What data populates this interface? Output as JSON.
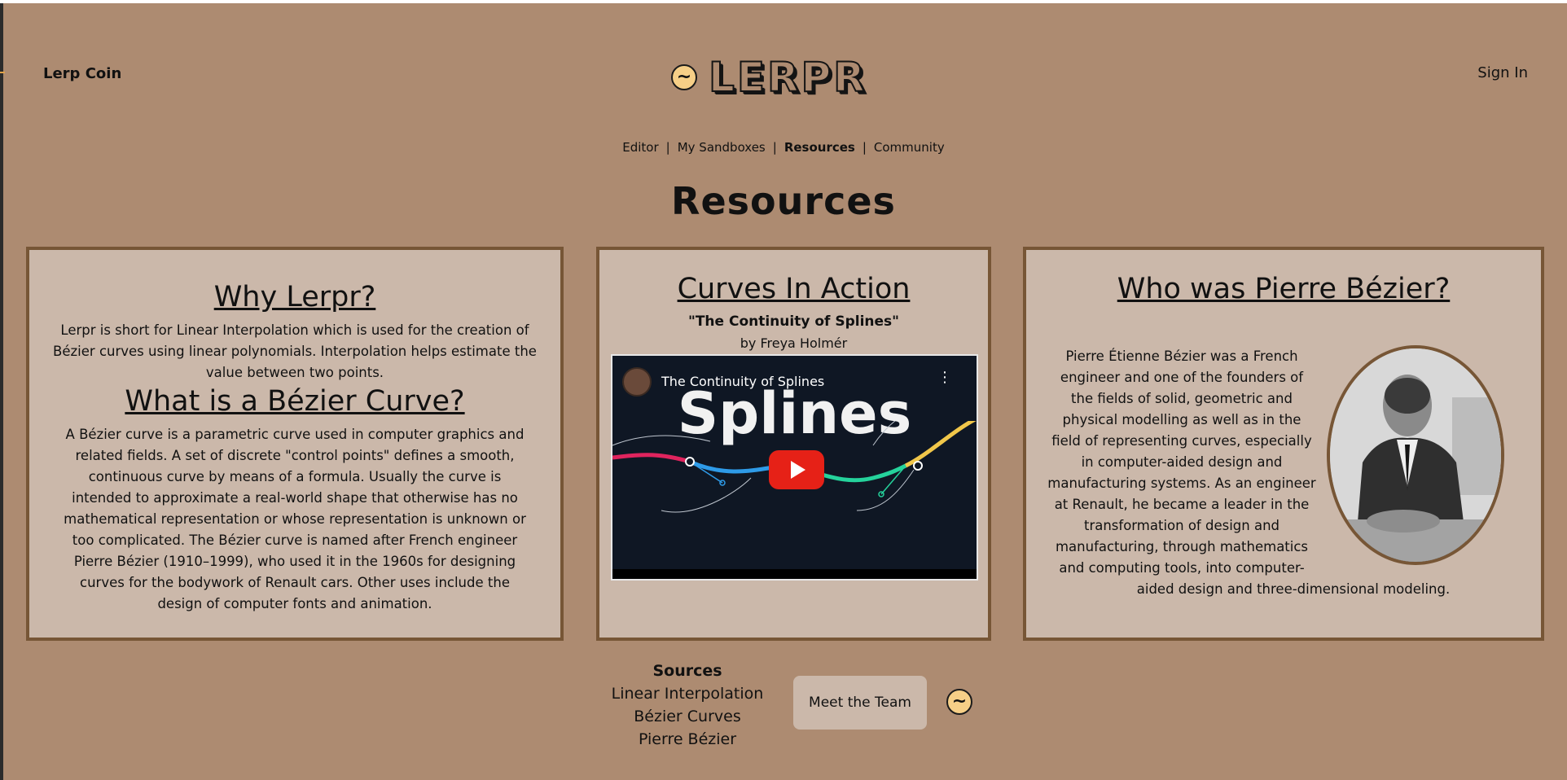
{
  "header": {
    "left_link": "Lerp Coin",
    "logo_text": "LERPR",
    "sign_in": "Sign In"
  },
  "nav": {
    "items": [
      "Editor",
      "My Sandboxes",
      "Resources",
      "Community"
    ],
    "active": "Resources",
    "separator": "|"
  },
  "page_title": "Resources",
  "why_card": {
    "why_heading": "Why Lerpr?",
    "why_text": "Lerpr is short for Linear Interpolation which is used for the creation of Bézier curves using linear polynomials. Interpolation helps estimate the value between two points.",
    "what_heading": "What is a Bézier Curve?",
    "what_text": "A Bézier curve is a parametric curve used in computer graphics and related fields. A set of discrete \"control points\" defines a smooth, continuous curve by means of a formula. Usually the curve is intended to approximate a real-world shape that otherwise has no mathematical representation or whose representation is unknown or too complicated. The Bézier curve is named after French engineer Pierre Bézier (1910–1999), who used it in the 1960s for designing curves for the bodywork of Renault cars. Other uses include the design of computer fonts and animation."
  },
  "curves_card": {
    "heading": "Curves In Action",
    "quote": "\"The Continuity of Splines\"",
    "byline": "by Freya Holmér",
    "video": {
      "title": "The Continuity of Splines",
      "big_text": "Splines"
    }
  },
  "bezier_card": {
    "heading": "Who was Pierre Bézier?",
    "bio_left": "Pierre Étienne Bézier was a French engineer and one of the founders of the fields of solid, geometric and physical modelling as well as in the field of representing curves, especially in computer-aided design and manufacturing systems. As an engineer at Renault, he became a leader in the transformation of design and manufacturing, through mathematics and computing tools, into computer-",
    "bio_last": "aided design and three-dimensional modeling."
  },
  "footer": {
    "sources_title": "Sources",
    "sources": [
      "Linear Interpolation",
      "Bézier Curves",
      "Pierre Bézier"
    ],
    "team_button": "Meet the Team"
  },
  "colors": {
    "background": "#ad8b71",
    "card": "#cbb8aa",
    "card_border": "#775636",
    "logo_icon": "#f6cf87"
  },
  "icons": [
    "wave-logo-icon",
    "youtube-play-icon",
    "more-vert-icon"
  ]
}
